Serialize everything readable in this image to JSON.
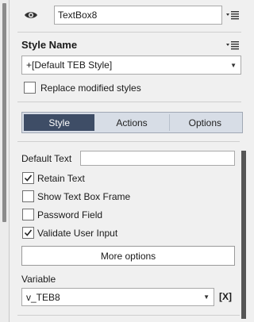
{
  "header": {
    "name_value": "TextBox8"
  },
  "style_section": {
    "title": "Style Name",
    "selected_style": "+[Default TEB Style]",
    "replace_label": "Replace modified styles"
  },
  "tabs": [
    {
      "label": "Style",
      "active": true
    },
    {
      "label": "Actions",
      "active": false
    },
    {
      "label": "Options",
      "active": false
    }
  ],
  "form": {
    "default_text_label": "Default Text",
    "default_text_value": "",
    "checkboxes": [
      {
        "label": "Retain Text",
        "checked": true
      },
      {
        "label": "Show Text Box Frame",
        "checked": false
      },
      {
        "label": "Password Field",
        "checked": false
      },
      {
        "label": "Validate User Input",
        "checked": true
      }
    ],
    "more_options_label": "More options",
    "variable_label": "Variable",
    "variable_value": "v_TEB8",
    "clear_variable_label": "[X]"
  },
  "icons": {
    "visibility": "eye-icon",
    "menu": "list-menu-icon",
    "dropdown": "chevron-down-icon",
    "checkmark": "checkmark-icon"
  },
  "colors": {
    "active_tab": "#3e4d66",
    "tab_bar": "#d7dde6",
    "panel": "#f0f0f0"
  }
}
